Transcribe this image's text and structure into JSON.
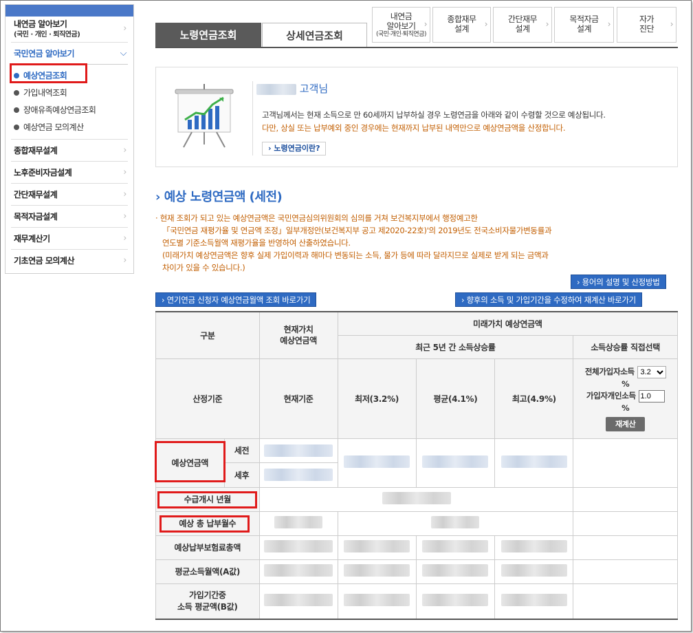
{
  "sidebar": {
    "items": [
      {
        "label": "내연금 알아보기",
        "sub": "(국민 · 개인 · 퇴직연금)"
      },
      {
        "label": "국민연금 알아보기"
      },
      {
        "label": "종합재무설계"
      },
      {
        "label": "노후준비자금설계"
      },
      {
        "label": "간단재무설계"
      },
      {
        "label": "목적자금설계"
      },
      {
        "label": "재무계산기"
      },
      {
        "label": "기초연금 모의계산"
      }
    ],
    "subitems": [
      "예상연금조회",
      "가입내역조회",
      "장애유족예상연금조회",
      "예상연금 모의계산"
    ]
  },
  "tabs": {
    "active": "노령연금조회",
    "inactive": "상세연금조회"
  },
  "quick": [
    {
      "line1": "내연금",
      "line2": "알아보기",
      "line3": "(국민·개인·퇴직연금)"
    },
    {
      "line1": "종합재무",
      "line2": "설계"
    },
    {
      "line1": "간단재무",
      "line2": "설계"
    },
    {
      "line1": "목적자금",
      "line2": "설계"
    },
    {
      "line1": "자가",
      "line2": "진단"
    }
  ],
  "info": {
    "customer_suffix": "고객님",
    "desc1": "고객님께서는 현재 소득으로 만 60세까지 납부하실 경우 노령연금을 아래와 같이 수령할 것으로 예상됩니다.",
    "desc2": "다만, 상실 또는 납부예외 중인 경우에는 현재까지 납부된 내역만으로 예상연금액을 산정합니다.",
    "button": "› 노령연금이란?"
  },
  "section_title": "예상 노령연금액 (세전)",
  "notes": [
    "· 현재 조회가 되고 있는 예상연금액은 국민연금심의위원회의 심의를 거쳐 보건복지부에서 행정예고한",
    "「국민연금 재평가율 및 연금액 조정」일부개정안(보건복지부 공고 제2020-22호)'의 2019년도 전국소비자물가변동률과",
    "연도별 기준소득월액 재평가율을 반영하여 산출하였습니다.",
    "(미래가치 예상연금액은 향후 실제 가입이력과 해마다 변동되는 소득, 물가 등에 따라 달라지므로 실제로 받게 되는 금액과",
    "차이가 있을 수 있습니다.)"
  ],
  "buttons": {
    "terms": "› 용어의 설명 및 산정방법",
    "deferred": "› 연기연금 신청자 예상연금월액 조회 바로가기",
    "recalc_link": "› 향후의 소득 및 가입기간을 수정하여 재계산 바로가기"
  },
  "table": {
    "h_category": "구분",
    "h_present": "현재가치\n예상연금액",
    "h_future": "미래가치 예상연금액",
    "h_recent": "최근 5년 간 소득상승률",
    "h_direct": "소득상승률 직접선택",
    "basis_label": "산정기준",
    "present_basis": "현재기준",
    "low": "최저(3.2%)",
    "avg": "평균(4.1%)",
    "high": "최고(4.9%)",
    "all_income_label": "전체가입자소득",
    "all_income_value": "3.2",
    "percent": "%",
    "personal_income_label": "가입자개인소득",
    "personal_income_value": "1.0",
    "recalc": "재계산",
    "expected": "예상연금액",
    "pre_tax": "세전",
    "post_tax": "세후",
    "start": "수급개시 년월",
    "months": "예상 총 납부월수",
    "premium": "예상납부보험료총액",
    "avg_a": "평균소득월액(A값)",
    "avg_b1": "가입기간중",
    "avg_b2": "소득 평균액(B값)"
  }
}
